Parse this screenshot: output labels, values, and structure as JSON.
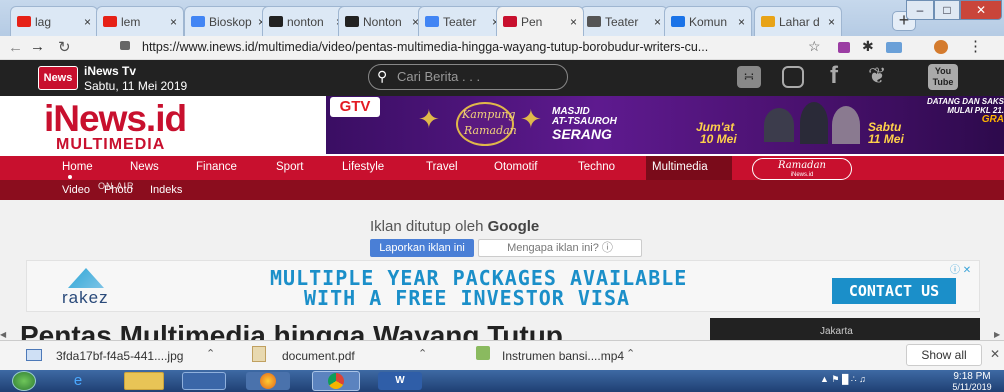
{
  "browser": {
    "tabs": [
      {
        "label": "lag",
        "icon": "youtube-icon",
        "color": "#e62117"
      },
      {
        "label": "lem",
        "icon": "youtube-icon",
        "color": "#e62117"
      },
      {
        "label": "Bioskop",
        "icon": "google-icon",
        "color": "#4285f4"
      },
      {
        "label": "nonton",
        "icon": "film-icon",
        "color": "#222222"
      },
      {
        "label": "Nonton",
        "icon": "film-icon",
        "color": "#222222"
      },
      {
        "label": "Teater",
        "icon": "google-icon",
        "color": "#4285f4"
      },
      {
        "label": "Pen",
        "icon": "inews-icon",
        "color": "#c8102e"
      },
      {
        "label": "Teater",
        "icon": "dramabox-icon",
        "color": "#555555"
      },
      {
        "label": "Komun",
        "icon": "arc-icon",
        "color": "#1a73e8"
      },
      {
        "label": "Lahar d",
        "icon": "t-icon",
        "color": "#e8a317"
      }
    ],
    "url": "https://www.inews.id/multimedia/video/pentas-multimedia-hingga-wayang-tutup-borobudur-writers-cu..."
  },
  "site": {
    "channel": "iNews Tv",
    "date": "Sabtu, 11 Mei 2019",
    "logo_small": "News",
    "search_placeholder": "Cari Berita . . .",
    "brand_main": "iNews.id",
    "brand_sub": "MULTIMEDIA",
    "nav": [
      "Home",
      "News",
      "Finance",
      "Sport",
      "Lifestyle",
      "Travel",
      "Otomotif",
      "Techno",
      "Multimedia"
    ],
    "ramadan_badge": "Ramadan",
    "ramadan_sub": "iNews.id",
    "subnav": [
      "Video",
      "Photo",
      "Indeks"
    ],
    "subnav_overlay": "ON AIR",
    "social": {
      "youtube_top": "You",
      "youtube_bottom": "Tube"
    }
  },
  "ad_banner": {
    "gtv": "GTV",
    "kampung": "Kampung",
    "ramadan": "Ramadan",
    "masjid_line1": "MASJID",
    "masjid_line2": "AT-TSAUROH",
    "masjid_line3": "SERANG",
    "date1_line1": "Jum'at",
    "date1_line2": "10 Mei",
    "date2_line1": "Sabtu",
    "date2_line2": "11 Mei",
    "top_right_line1": "DATANG DAN SAKS",
    "top_right_line2": "MULAI PKL 21.",
    "top_right_line3": "GRA"
  },
  "google_ad": {
    "closed_text": "Iklan ditutup oleh",
    "google": "Google",
    "report_btn": "Laporkan iklan ini",
    "why_btn": "Mengapa iklan ini? ⓘ"
  },
  "rakez": {
    "logo": "rakez",
    "headline1": "MULTIPLE YEAR PACKAGES AVAILABLE",
    "headline2": "WITH A FREE INVESTOR VISA",
    "cta": "CONTACT US",
    "ad_marks": "ⓘ ✕"
  },
  "article": {
    "title_fragment": "Pentas Multimedia hingga Wayang Tutup",
    "side_label": "Jakarta"
  },
  "downloads": {
    "items": [
      "3fda17bf-f4a5-441....jpg",
      "document.pdf",
      "Instrumen bansi....mp4"
    ],
    "show_all": "Show all"
  },
  "taskbar": {
    "time": "9:18 PM",
    "date": "5/11/2019"
  }
}
